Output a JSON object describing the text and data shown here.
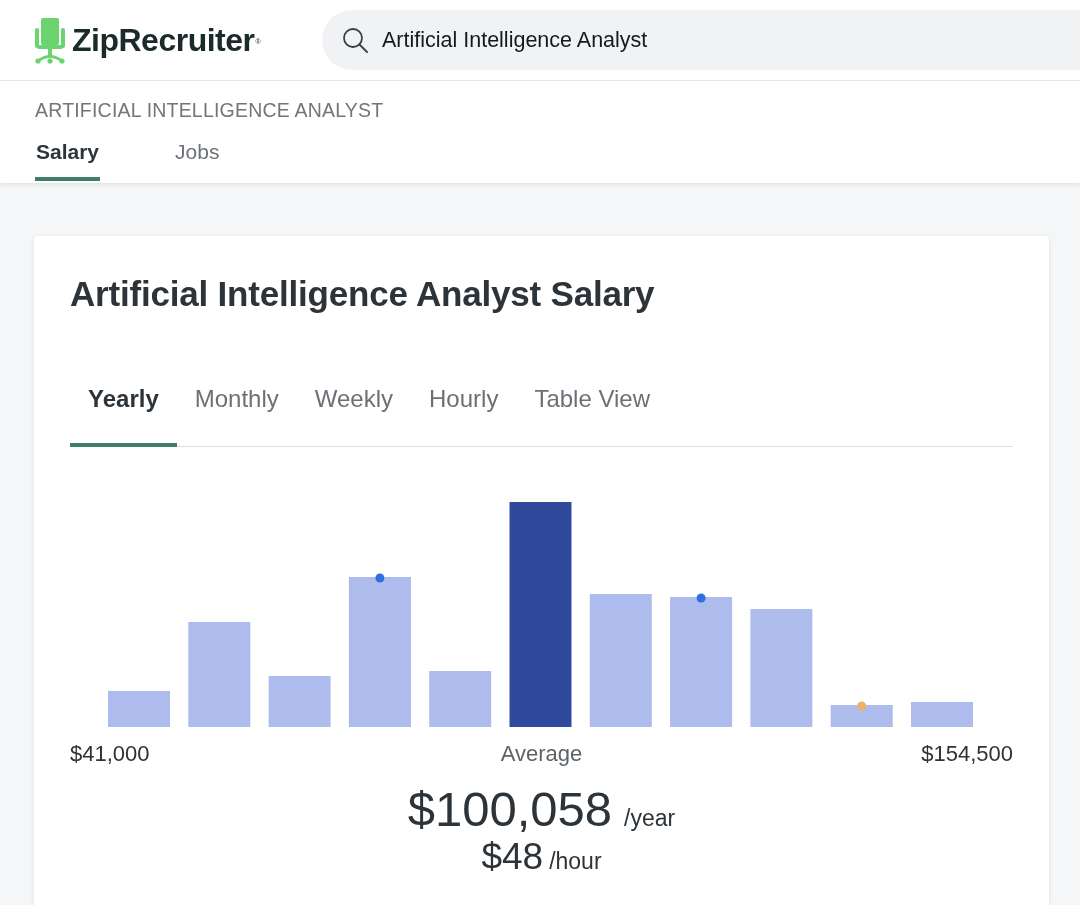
{
  "header": {
    "logo": {
      "text": "ZipRecruiter",
      "mark": "®"
    },
    "search": {
      "value": "Artificial Intelligence Analyst"
    }
  },
  "subnav": {
    "title": "ARTIFICIAL INTELLIGENCE ANALYST",
    "tabs": [
      {
        "label": "Salary",
        "selected": true
      },
      {
        "label": "Jobs",
        "selected": false
      }
    ]
  },
  "salary_card": {
    "title": "Artificial Intelligence Analyst Salary",
    "tabs": [
      {
        "label": "Yearly",
        "selected": true
      },
      {
        "label": "Monthly",
        "selected": false
      },
      {
        "label": "Weekly",
        "selected": false
      },
      {
        "label": "Hourly",
        "selected": false
      },
      {
        "label": "Table View",
        "selected": false
      }
    ],
    "range": {
      "low": "$41,000",
      "middle": "Average",
      "high": "$154,500"
    },
    "average": {
      "primary": {
        "amount": "$100,058",
        "unit": "/year"
      },
      "secondary": {
        "amount": "$48",
        "unit": "/hour"
      }
    }
  }
}
